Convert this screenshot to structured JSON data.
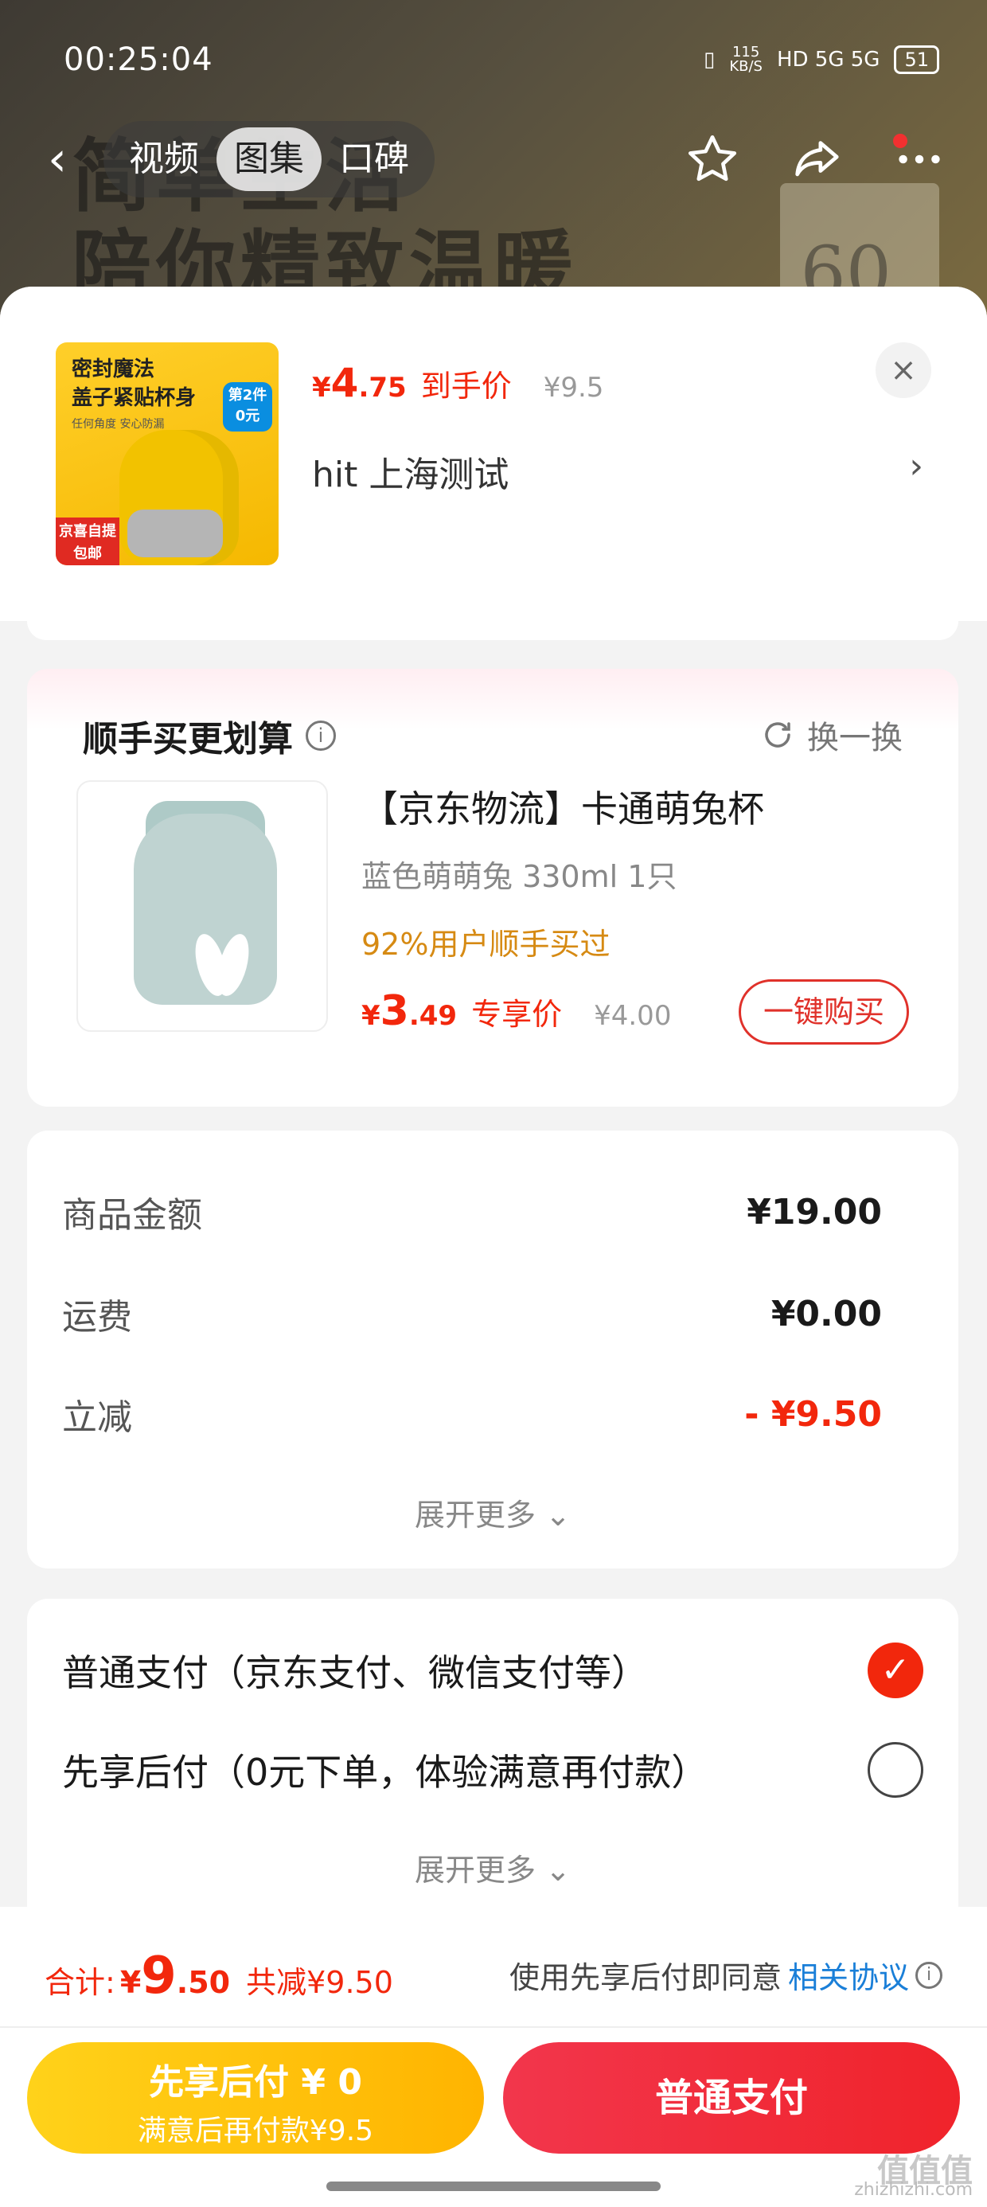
{
  "status_bar": {
    "time": "00:25:04",
    "speed": "115\nKB/S",
    "network": "HD 5G 5G",
    "battery": "51"
  },
  "background": {
    "line1": "简单生活",
    "line2": "陪你精致温暖",
    "number": "60"
  },
  "nav": {
    "tabs": [
      "视频",
      "图集",
      "口碑"
    ],
    "active_tab": "图集"
  },
  "product": {
    "image_title": "密封魔法\n盖子紧贴杯身",
    "image_sub": "任何角度 安心防漏",
    "image_badge": "第2件\n0元",
    "image_jd_badge": "京喜自提\n包邮",
    "price_symbol": "¥",
    "price_int": "4",
    "price_dec": ".75",
    "price_label": "到手价",
    "orig_price": "¥9.5",
    "address": "hit  上海测试",
    "chevron": "›",
    "close": "×"
  },
  "recommend": {
    "title": "顺手买更划算",
    "info_icon": "i",
    "swap_label": "换一换",
    "name": "【京东物流】卡通萌兔杯",
    "spec": "蓝色萌萌兔 330ml 1只",
    "tag": "92%用户顺手买过",
    "price_symbol": "¥",
    "price_int": "3",
    "price_dec": ".49",
    "price_label": "专享价",
    "orig_price": "¥4.00",
    "buy_label": "一键购买"
  },
  "summary": {
    "rows": [
      {
        "label": "商品金额",
        "value": "¥19.00"
      },
      {
        "label": "运费",
        "value": "¥0.00"
      },
      {
        "label": "立减",
        "value": "- ¥9.50"
      }
    ],
    "expand": "展开更多 ⌄"
  },
  "payment": {
    "options": [
      {
        "label": "普通支付（京东支付、微信支付等）",
        "selected": true
      },
      {
        "label": "先享后付（0元下单，体验满意再付款）",
        "selected": false
      }
    ],
    "expand": "展开更多 ⌄"
  },
  "footer": {
    "total_label": "合计:",
    "total_symbol": "¥",
    "total_int": "9",
    "total_dec": ".50",
    "saved": "共减¥9.50",
    "agree_text": "使用先享后付即同意",
    "agree_link": "相关协议",
    "btn_later_line1": "先享后付 ¥ 0",
    "btn_later_line2": "满意后再付款¥9.5",
    "btn_normal": "普通支付",
    "watermark_big": "值值值",
    "watermark_small": "zhizhizhi.com"
  },
  "colors": {
    "accent_red": "#f2270c",
    "gold": "#ffc107",
    "tag_orange": "#d68a13",
    "link_blue": "#1a7fd8"
  }
}
